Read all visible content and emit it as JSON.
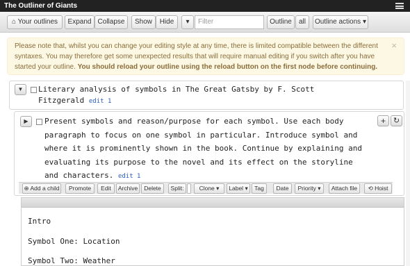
{
  "app": {
    "title": "The Outliner of Giants"
  },
  "toolbar": {
    "your_outlines": "Your outlines",
    "expand": "Expand",
    "collapse": "Collapse",
    "show": "Show",
    "hide": "Hide",
    "filter_placeholder": "Filter",
    "outline": "Outline",
    "all": "all",
    "outline_actions": "Outline actions"
  },
  "alert": {
    "text": "Please note that, whilst you can change your editing style at any time, there is limited compatible between the different syntaxes. You may therefore get some unexpected results that will require manual editing if you switch after you have started your outline.",
    "bold": "You should reload your outline using the reload button on the first node before continuing.",
    "close": "×"
  },
  "nodes": [
    {
      "lines": [
        "Literary analysis of symbols in The Great Gatsby by F. Scott",
        "Fitzgerald"
      ],
      "edit": "edit 1"
    },
    {
      "lines": [
        "Present symbols and reason/purpose for each symbol. Use each body",
        "paragraph to focus on one symbol in particular. Introduce symbol and",
        "where it is prominently shown in the book. Continue by explaining and",
        "evaluating its purpose to the novel and its effect on the storyline",
        "and characters."
      ],
      "edit": "edit 1"
    }
  ],
  "node_actions": {
    "add_child": "Add a child",
    "promote": "Promote",
    "edit": "Edit",
    "archive": "Archive",
    "delete": "Delete",
    "split": "Split:",
    "clone": "Clone",
    "label": "Label",
    "tag": "Tag",
    "date": "Date",
    "priority": "Priority",
    "attach": "Attach file",
    "hoist": "Hoist"
  },
  "children_pane": {
    "lines": [
      "Intro",
      "Symbol One: Location",
      "Symbol Two: Weather"
    ]
  },
  "colors": {
    "titlebar": "#222222",
    "alert_bg": "#fcf8e3",
    "alert_text": "#8a6d3b",
    "edit_link": "#2a5dbf"
  }
}
